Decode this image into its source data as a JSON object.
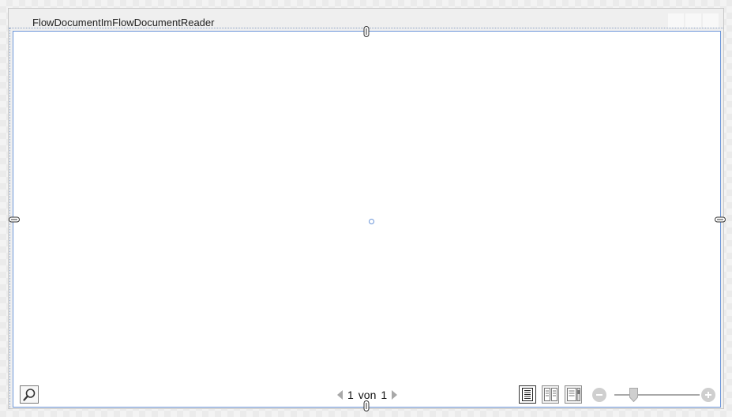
{
  "window": {
    "title": "FlowDocumentImFlowDocumentReader"
  },
  "reader": {
    "pager": {
      "current_page": "1",
      "separator": "von",
      "total_pages": "1"
    },
    "view_modes": [
      "page",
      "two-page",
      "scroll"
    ],
    "active_view_mode": "page",
    "zoom": {
      "level": 0.2
    }
  },
  "icons": {
    "search": "search-icon",
    "prev": "previous-page-icon",
    "next": "next-page-icon",
    "zoom_out": "zoom-out-icon",
    "zoom_in": "zoom-in-icon"
  },
  "colors": {
    "selection_border": "#6d96d9",
    "document_background": "#ffffff",
    "window_background": "#efefef"
  }
}
